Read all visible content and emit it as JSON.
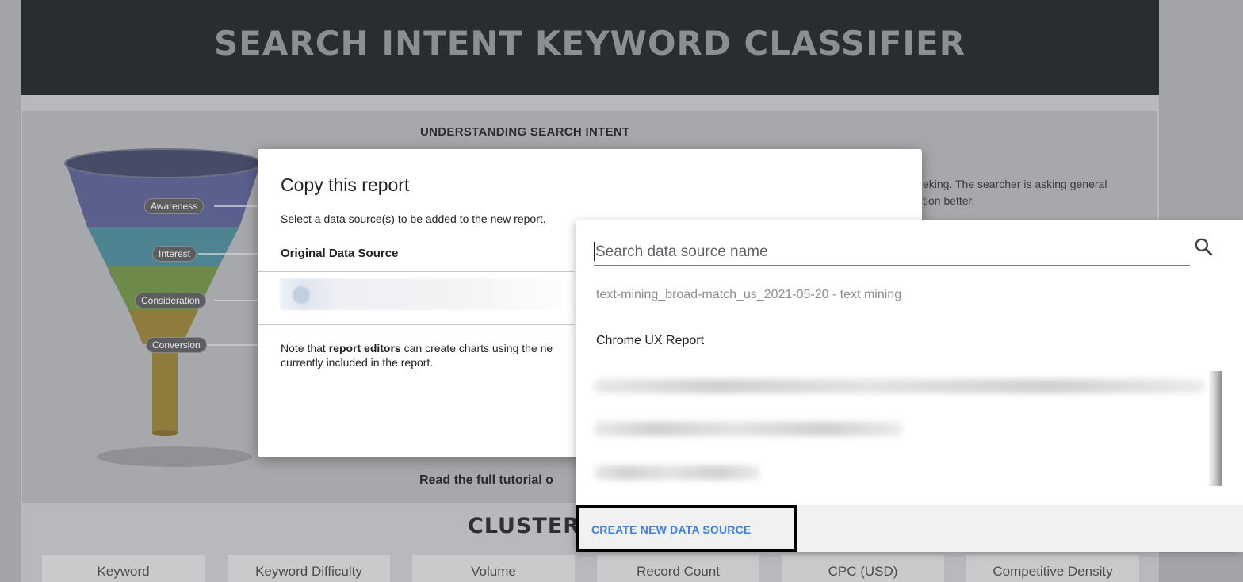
{
  "report": {
    "title": "SEARCH INTENT KEYWORD CLASSIFIER",
    "section_heading": "UNDERSTANDING SEARCH INTENT",
    "section_text_line1": "eking. The searcher is asking general",
    "section_text_line2": "tion better.",
    "tutorial_text": "Read the full tutorial o",
    "cluster_heading": "CLUSTER",
    "funnel_stages": [
      "Awareness",
      "Interest",
      "Consideration",
      "Conversion"
    ],
    "columns": [
      "Keyword",
      "Keyword Difficulty",
      "Volume",
      "Record Count",
      "CPC (USD)",
      "Competitive Density"
    ]
  },
  "modal": {
    "title": "Copy this report",
    "subtitle": "Select a data source(s) to be added to the new report.",
    "original_ds_label": "Original Data Source",
    "note_prefix": "Note that ",
    "note_bold": "report editors",
    "note_middle": " can create charts using the ne",
    "note_line2": "currently included in the report."
  },
  "dropdown": {
    "search_placeholder": "Search data source name",
    "items": [
      "text-mining_broad-match_us_2021-05-20 - text mining",
      "Chrome UX Report"
    ],
    "create_new_label": "CREATE NEW DATA SOURCE"
  },
  "colors": {
    "accent_blue": "#3b82f0",
    "header_dark": "#282d30"
  },
  "icons": [
    "search-icon"
  ]
}
